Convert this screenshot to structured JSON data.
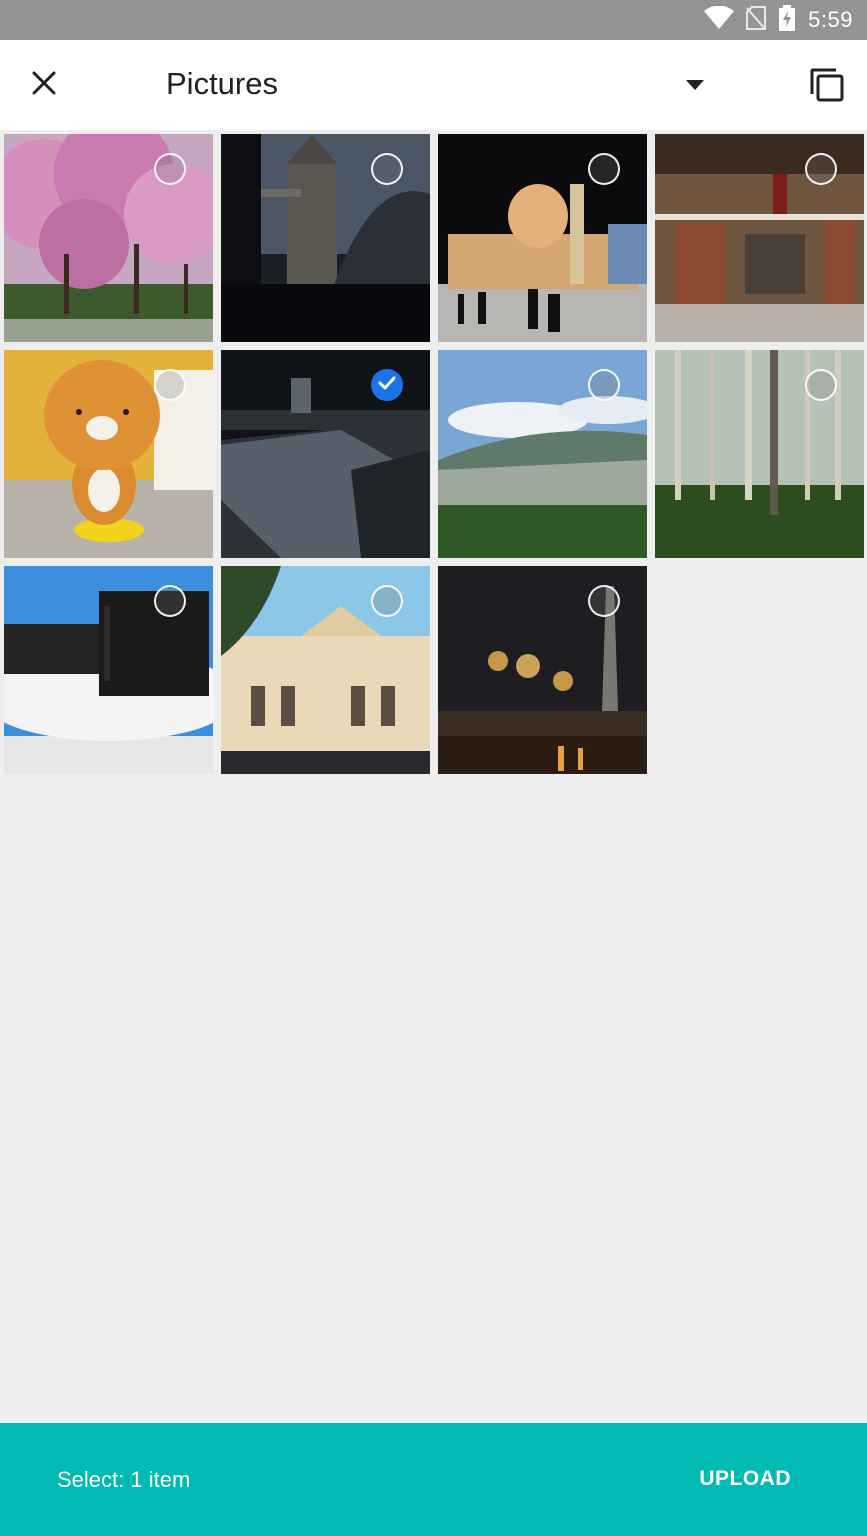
{
  "status_bar": {
    "time": "5:59",
    "icons": [
      "wifi-icon",
      "no-sim-icon",
      "battery-charging-icon"
    ]
  },
  "toolbar": {
    "title": "Pictures",
    "close_icon": "close-icon",
    "dropdown_icon": "dropdown-arrow-icon",
    "copy_icon": "copy-icon"
  },
  "photos": [
    {
      "subject": "cherry-blossom",
      "selected": false
    },
    {
      "subject": "tower-bridge",
      "selected": false
    },
    {
      "subject": "mosque-night",
      "selected": false
    },
    {
      "subject": "shrine-gate",
      "selected": false
    },
    {
      "subject": "bear-figure",
      "selected": false
    },
    {
      "subject": "light-field-night",
      "selected": true
    },
    {
      "subject": "valley-landscape",
      "selected": false
    },
    {
      "subject": "poplar-forest",
      "selected": false
    },
    {
      "subject": "nas-device",
      "selected": false
    },
    {
      "subject": "palace-building",
      "selected": false
    },
    {
      "subject": "tower-night-river",
      "selected": false
    }
  ],
  "bottom_bar": {
    "select_label": "Select: 1 item",
    "upload_label": "UPLOAD"
  },
  "colors": {
    "accent": "#00bab3",
    "check": "#1a73e8",
    "status_bar": "#949494"
  }
}
